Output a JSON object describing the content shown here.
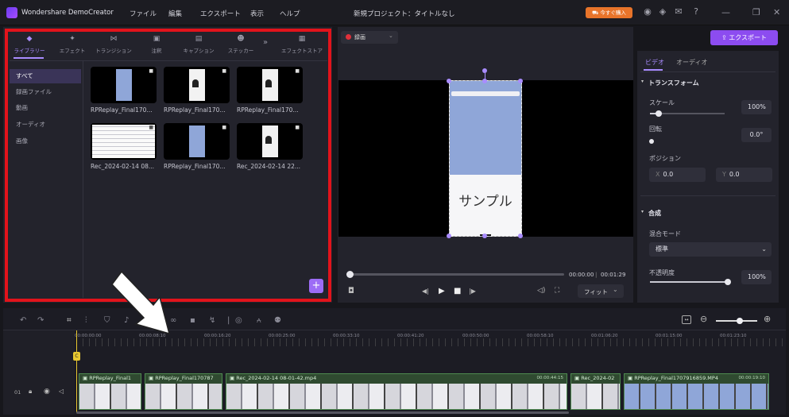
{
  "app": {
    "title": "Wondershare DemoCreator"
  },
  "menu": [
    "ファイル",
    "編集",
    "エクスポート",
    "表示",
    "ヘルプ"
  ],
  "project_title": "新規プロジェクト：タイトルなし",
  "buy_label": "今すぐ購入",
  "library": {
    "tabs": [
      "ライブラリー",
      "エフェクト",
      "トランジション",
      "注釈",
      "キャプション",
      "ステッカー",
      "エフェクトストア"
    ],
    "categories": [
      "すべて",
      "録画ファイル",
      "動画",
      "オーディオ",
      "画像"
    ],
    "media": [
      {
        "name": "RPReplay_Final170..."
      },
      {
        "name": "RPReplay_Final170..."
      },
      {
        "name": "RPReplay_Final170..."
      },
      {
        "name": "Rec_2024-02-14 08..."
      },
      {
        "name": "RPReplay_Final170..."
      },
      {
        "name": "Rec_2024-02-14 22..."
      }
    ],
    "add_label": "+"
  },
  "preview": {
    "record_label": "録画",
    "sample_text": "サンプル",
    "time_current": "00:00:00",
    "time_total": "00:01:29",
    "fit_label": "フィット"
  },
  "export_label": "エクスポート",
  "props": {
    "tabs": [
      "ビデオ",
      "オーディオ"
    ],
    "transform_title": "トランスフォーム",
    "scale_label": "スケール",
    "scale_value": "100%",
    "scale_level": 0.12,
    "rotate_label": "回転",
    "rotate_value": "0.0°",
    "position_label": "ポジション",
    "x_label": "X",
    "x_value": "0.0",
    "y_label": "Y",
    "y_value": "0.0",
    "composite_title": "合成",
    "blend_label": "混合モード",
    "blend_value": "標準",
    "opacity_label": "不透明度",
    "opacity_value": "100%",
    "opacity_level": 1.0
  },
  "timeline": {
    "ruler": [
      "00:00:00:00",
      "00:00:08:10",
      "00:00:16:20",
      "00:00:25:00",
      "00:00:33:10",
      "00:00:41:20",
      "00:00:50:00",
      "00:00:58:10",
      "00:01:06:20",
      "00:01:15:00",
      "00:01:23:10"
    ],
    "track_label": "01",
    "clips": [
      {
        "name": "RPReplay_Final1",
        "duration": ""
      },
      {
        "name": "RPReplay_Final170787",
        "duration": ""
      },
      {
        "name": "Rec_2024-02-14 08-01-42.mp4",
        "duration": "00:00:44:15"
      },
      {
        "name": "Rec_2024-02",
        "duration": ""
      },
      {
        "name": "RPReplay_Final1707916859.MP4",
        "duration": "00:00:19:10"
      }
    ]
  },
  "colors": {
    "accent": "#a98cff",
    "export": "#8c4cf0",
    "record": "#e0303a",
    "highlight": "#e2131b",
    "playhead": "#e8c830"
  }
}
